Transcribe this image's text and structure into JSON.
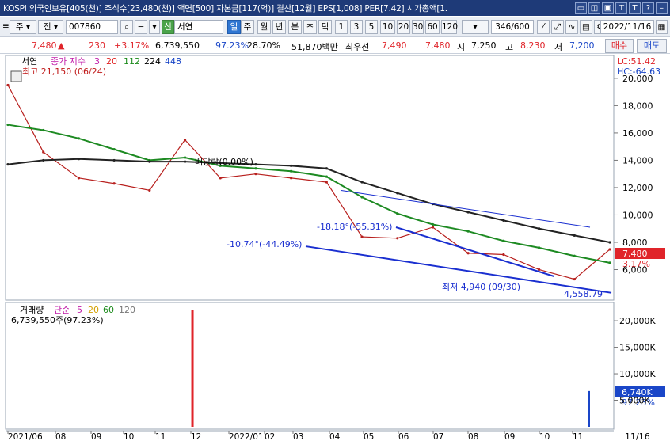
{
  "title_bar": {
    "info": "KOSPI 외국인보유[405(천)] 주식수[23,480(천)] 액면[500] 자본금[117(억)] 결산[12월] EPS[1,008] PER[7.42] 시가총액[1.",
    "icons": [
      "window-icon",
      "split-icon",
      "lock-icon",
      "pin-icon",
      "text-icon",
      "help-icon",
      "minimize-icon"
    ]
  },
  "toolbar": {
    "stock_type": "주",
    "compare": "전",
    "code": "007860",
    "market_badge": "신",
    "name": "서연",
    "periods": [
      "일",
      "주",
      "월",
      "년",
      "분",
      "초",
      "틱"
    ],
    "intervals": [
      "1",
      "3",
      "5",
      "10",
      "20",
      "30",
      "60",
      "120"
    ],
    "active_period": "일",
    "range": "346/600",
    "date": "2022/11/16"
  },
  "price_row": {
    "price": "7,480",
    "change": "230",
    "change_pct": "+3.17%",
    "volume": "6,739,550",
    "vol_ratio": "97.23%",
    "turnover": "28.70%",
    "amount": "51,870백만",
    "best_ask_label": "최우선",
    "best_ask": "7,490",
    "best_bid": "7,480",
    "open_label": "시",
    "open": "7,250",
    "high_label": "고",
    "high": "8,230",
    "low_label": "저",
    "low": "7,200",
    "buy_button": "매수",
    "sell_button": "매도"
  },
  "price_panel": {
    "stock_label": "서연",
    "legend_prefix": "종가 지수",
    "ma_periods": [
      "3",
      "20",
      "112",
      "224",
      "448"
    ],
    "high_marker": "최고 21,150 (06/24)",
    "low_marker": "최저 4,940 (09/30)",
    "support_label": "4,558.79",
    "trendline_a": "-10.74°(-44.49%)",
    "trendline_b": "-18.18°(-55.31%)",
    "ex_rights": "배당락(0.00%)",
    "lc": "LC:51.42",
    "hc": "HC:-64.63",
    "current_price_tag": "7,480",
    "current_pct": "3.17%",
    "y_ticks": [
      "20,000",
      "18,000",
      "16,000",
      "14,000",
      "12,000",
      "10,000",
      "8,000",
      "6,000"
    ]
  },
  "volume_panel": {
    "label": "거래량",
    "legend_prefix": "단순",
    "ma_periods": [
      "5",
      "20",
      "60",
      "120"
    ],
    "value_text": "6,739,550주(97.23%)",
    "current_tag": "6,740K",
    "current_pct": "97.23%",
    "y_ticks": [
      "20,000K",
      "15,000K",
      "10,000K",
      "5,000K"
    ]
  },
  "x_axis": {
    "labels": [
      "2021/06",
      "08",
      "09",
      "10",
      "11",
      "12",
      "2022/01",
      "02",
      "03",
      "04",
      "05",
      "06",
      "07",
      "08",
      "09",
      "10",
      "11"
    ],
    "right_label": "11/16"
  },
  "chart_data": {
    "type": "line",
    "title": "",
    "x": [
      "2021/06",
      "2021/07",
      "2021/08",
      "2021/09",
      "2021/10",
      "2021/11",
      "2021/12",
      "2022/01",
      "2022/02",
      "2022/03",
      "2022/04",
      "2022/05",
      "2022/06",
      "2022/07",
      "2022/08",
      "2022/09",
      "2022/10",
      "2022/11"
    ],
    "series": [
      {
        "name": "종가",
        "values": [
          19500,
          14600,
          12700,
          12300,
          11800,
          15500,
          12700,
          13000,
          12700,
          12400,
          8400,
          8300,
          9100,
          7200,
          7100,
          6000,
          5300,
          7480
        ]
      },
      {
        "name": "112",
        "values": [
          16600,
          16200,
          15600,
          14800,
          14000,
          14200,
          13600,
          13400,
          13200,
          12800,
          11300,
          10100,
          9300,
          8800,
          8100,
          7600,
          7000,
          6500
        ]
      },
      {
        "name": "224",
        "values": [
          13700,
          14000,
          14100,
          14000,
          13900,
          13900,
          13800,
          13700,
          13600,
          13400,
          12400,
          11600,
          10800,
          10200,
          9600,
          9000,
          8500,
          8000
        ]
      }
    ],
    "volume_bars": [
      {
        "x": "2021/11",
        "value": 22000000
      },
      {
        "x": "2022/11",
        "value": 6740000
      }
    ],
    "ylim": [
      4000,
      21500
    ],
    "volume_ylim": [
      0,
      23000000
    ]
  }
}
